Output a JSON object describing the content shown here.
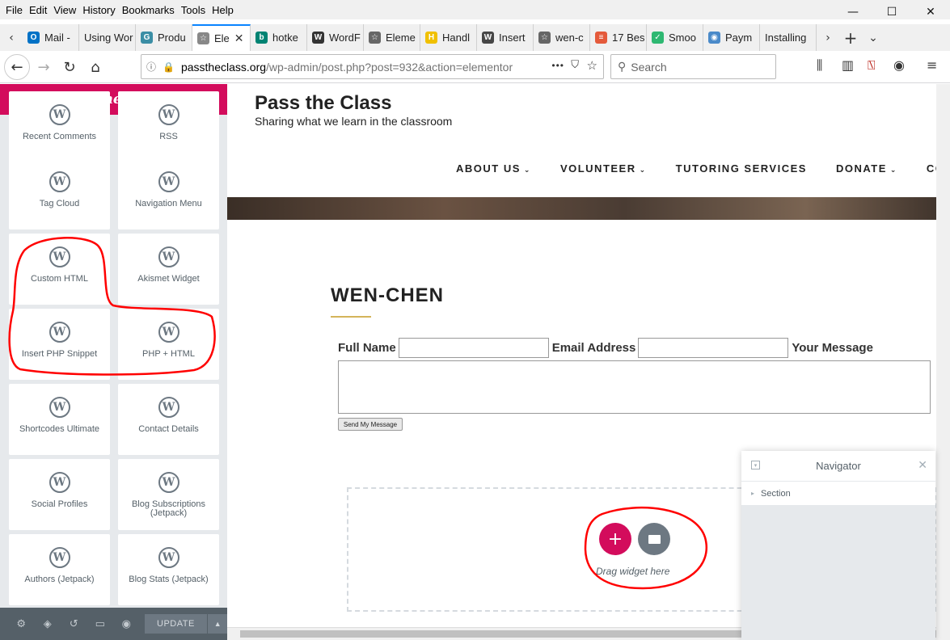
{
  "menu": [
    {
      "key": "F",
      "rest": "ile"
    },
    {
      "key": "E",
      "rest": "dit"
    },
    {
      "key": "V",
      "rest": "iew"
    },
    {
      "key": "",
      "pre": "Hi",
      "key2": "s",
      "rest": "tory"
    },
    {
      "key": "B",
      "rest": "ookmarks"
    },
    {
      "key": "T",
      "rest": "ools"
    },
    {
      "key": "H",
      "rest": "elp"
    }
  ],
  "menu_labels": [
    "File",
    "Edit",
    "View",
    "History",
    "Bookmarks",
    "Tools",
    "Help"
  ],
  "window_controls": {
    "minimize": "—",
    "maximize": "☐",
    "close": "✕"
  },
  "tabs": [
    {
      "label": "Mail -",
      "icon": "outlook-icon",
      "color": "#0072c6",
      "glyph": "O"
    },
    {
      "label": "Using Wor",
      "icon": "none",
      "color": "",
      "glyph": ""
    },
    {
      "label": "Produ",
      "icon": "gravity-icon",
      "color": "#3b8ea5",
      "glyph": "G"
    },
    {
      "label": "Ele",
      "icon": "elementor-icon",
      "color": "#888",
      "glyph": "☆",
      "active": true
    },
    {
      "label": "hotke",
      "icon": "bing-icon",
      "color": "#008373",
      "glyph": "b"
    },
    {
      "label": "WordF",
      "icon": "wikipedia-icon",
      "color": "#333",
      "glyph": "W"
    },
    {
      "label": "Eleme",
      "icon": "star-icon",
      "color": "#666",
      "glyph": "☆"
    },
    {
      "label": "Handl",
      "icon": "handlebars-icon",
      "color": "#f0c000",
      "glyph": "H"
    },
    {
      "label": "Insert",
      "icon": "wordpress-icon",
      "color": "#464646",
      "glyph": "W"
    },
    {
      "label": "wen-c",
      "icon": "star-icon",
      "color": "#666",
      "glyph": "☆"
    },
    {
      "label": "17 Bes",
      "icon": "doc-icon",
      "color": "#e45a3b",
      "glyph": "≡"
    },
    {
      "label": "Smoo",
      "icon": "check-icon",
      "color": "#2eb872",
      "glyph": "✓"
    },
    {
      "label": "Paym",
      "icon": "globe-icon",
      "color": "#4a8ac9",
      "glyph": "◉"
    },
    {
      "label": "Installing",
      "icon": "none",
      "color": "",
      "glyph": ""
    }
  ],
  "nav": {
    "url_host": "passtheclass.org",
    "url_path": "/wp-admin/post.php?post=932&action=elementor",
    "search_placeholder": "Search",
    "more": "•••"
  },
  "panel": {
    "logo": "elementor",
    "widgets": [
      {
        "label": "Recent Comments"
      },
      {
        "label": "RSS"
      },
      {
        "label": "Tag Cloud"
      },
      {
        "label": "Navigation Menu"
      },
      {
        "label": "Custom HTML"
      },
      {
        "label": "Akismet Widget"
      },
      {
        "label": "Insert PHP Snippet"
      },
      {
        "label": "PHP + HTML"
      },
      {
        "label": "Shortcodes Ultimate"
      },
      {
        "label": "Contact Details"
      },
      {
        "label": "Social Profiles"
      },
      {
        "label": "Blog Subscriptions (Jetpack)"
      },
      {
        "label": "Authors (Jetpack)"
      },
      {
        "label": "Blog Stats (Jetpack)"
      }
    ],
    "update_label": "UPDATE",
    "update_caret": "▲",
    "footer_icons": [
      "gear-icon",
      "layers-icon",
      "history-icon",
      "responsive-icon",
      "eye-icon"
    ]
  },
  "site": {
    "title": "Pass the Class",
    "tagline": "Sharing what we learn in the classroom",
    "menu": [
      {
        "label": "ABOUT US",
        "dropdown": "⌄"
      },
      {
        "label": "VOLUNTEER",
        "dropdown": "⌄"
      },
      {
        "label": "TUTORING SERVICES",
        "dropdown": ""
      },
      {
        "label": "DONATE",
        "dropdown": "⌄"
      },
      {
        "label": "CONT",
        "dropdown": ""
      }
    ],
    "heading": "WEN-CHEN",
    "form": {
      "full_name_label": "Full Name",
      "email_label": "Email Address",
      "message_label": "Your Message",
      "send_label": "Send My Message"
    },
    "drag_hint": "Drag widget here",
    "add_glyph": "+"
  },
  "navigator": {
    "title": "Navigator",
    "close": "✕",
    "toggle": "▾",
    "section_label": "Section",
    "section_caret": "▸"
  },
  "colors": {
    "brand": "#d30c5c",
    "annotation": "#ff0000",
    "accent_underline": "#d4b45a"
  }
}
